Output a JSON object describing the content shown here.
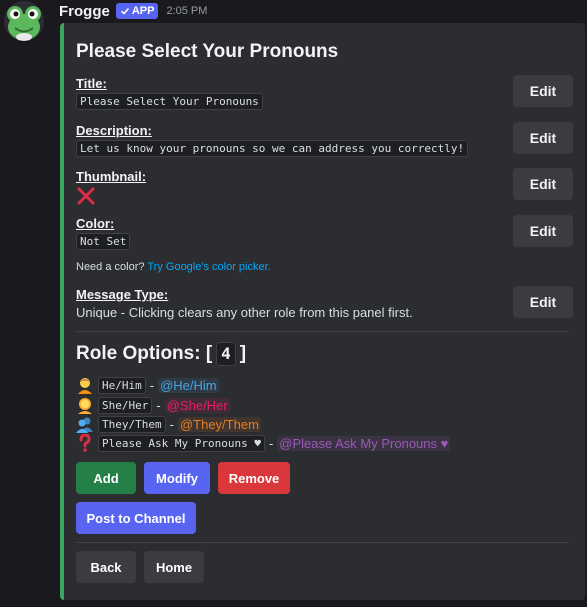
{
  "header": {
    "bot_name": "Frogge",
    "badge_label": "APP",
    "timestamp": "2:05 PM"
  },
  "embed": {
    "title": "Please Select Your Pronouns",
    "accent_color": "#3ba55d",
    "fields": {
      "title": {
        "name": "Title:",
        "value": "Please Select Your Pronouns"
      },
      "description": {
        "name": "Description:",
        "value": "Let us know your pronouns so we can address you correctly!"
      },
      "thumbnail": {
        "name": "Thumbnail:",
        "value_icon": "cross-mark-icon"
      },
      "color": {
        "name": "Color:",
        "value": "Not Set"
      },
      "message_type": {
        "name": "Message Type:",
        "value": "Unique - Clicking clears any other role from this panel first."
      }
    },
    "color_hint": {
      "prefix": "Need a color? ",
      "link": "Try Google's color picker."
    },
    "edit_label": "Edit",
    "role_options": {
      "heading": "Role Options: [",
      "count": "4",
      "close": "]",
      "roles": [
        {
          "emoji": "person-yellow-icon",
          "name": "He/Him",
          "mention": "@He/Him",
          "color": "#4aa3df"
        },
        {
          "emoji": "person-blonde-icon",
          "name": "She/Her",
          "mention": "@She/Her",
          "color": "#e91e63"
        },
        {
          "emoji": "people-silhouette-icon",
          "name": "They/Them",
          "mention": "@They/Them",
          "color": "#e67e22"
        },
        {
          "emoji": "question-mark-icon",
          "name": "Please Ask My Pronouns ♥",
          "mention": "@Please Ask My Pronouns ♥",
          "color": "#9b59b6"
        }
      ]
    }
  },
  "buttons": {
    "add": "Add",
    "modify": "Modify",
    "remove": "Remove",
    "post": "Post to Channel",
    "back": "Back",
    "home": "Home"
  },
  "separator": "-"
}
